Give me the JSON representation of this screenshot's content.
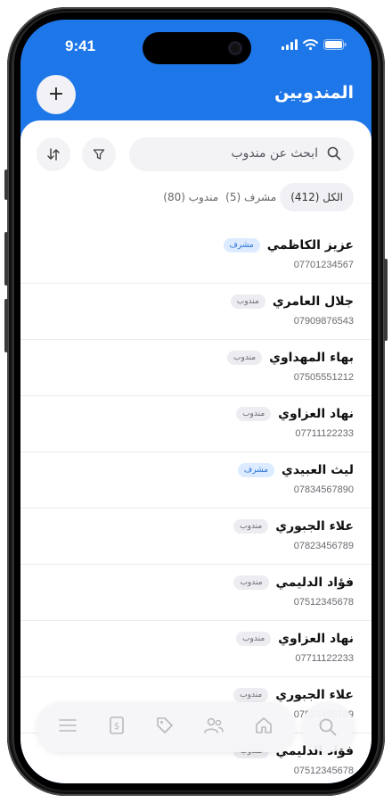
{
  "status_bar": {
    "time": "9:41"
  },
  "header": {
    "title": "المندوبين",
    "add_label": "+"
  },
  "search": {
    "placeholder": "ابحث عن مندوب"
  },
  "filters": [
    {
      "label": "الكل (412)"
    },
    {
      "label": "مشرف (5)"
    },
    {
      "label": "مندوب (80)"
    }
  ],
  "delegates": [
    {
      "name": "عزيز الكاظمي",
      "phone": "07701234567",
      "role": "مشرف"
    },
    {
      "name": "جلال العامري",
      "phone": "07909876543",
      "role": "مندوب"
    },
    {
      "name": "بهاء المهداوي",
      "phone": "07505551212",
      "role": "مندوب"
    },
    {
      "name": "نهاد العزاوي",
      "phone": "07711122233",
      "role": "مندوب"
    },
    {
      "name": "ليث العبيدي",
      "phone": "07834567890",
      "role": "مشرف"
    },
    {
      "name": "علاء الجبوري",
      "phone": "07823456789",
      "role": "مندوب"
    },
    {
      "name": "فؤاد الدليمي",
      "phone": "07512345678",
      "role": "مندوب"
    },
    {
      "name": "نهاد العزاوي",
      "phone": "07711122233",
      "role": "مندوب"
    },
    {
      "name": "علاء الجبوري",
      "phone": "07823456789",
      "role": "مندوب"
    },
    {
      "name": "فؤاد الدليمي",
      "phone": "07512345678",
      "role": "مندوب"
    }
  ],
  "tab_bar": {
    "items": [
      {
        "icon": "menu-icon"
      },
      {
        "icon": "invoice-icon"
      },
      {
        "icon": "tag-icon"
      },
      {
        "icon": "users-icon"
      },
      {
        "icon": "home-icon"
      }
    ],
    "search_icon": "search-icon"
  },
  "colors": {
    "accent": "#1e77e8",
    "supervisor_badge_bg": "#dcebff",
    "rep_badge_bg": "#ececf1"
  }
}
